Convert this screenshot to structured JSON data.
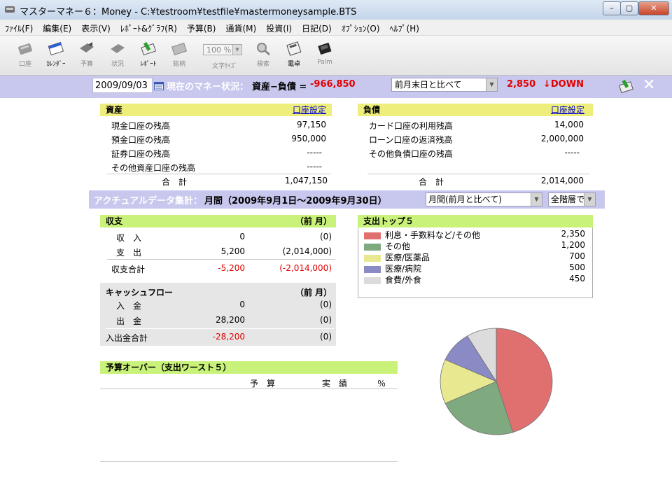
{
  "window": {
    "title": "マスターマネー６：Money - C:¥testroom¥testfile¥mastermoneysample.BTS",
    "btn_min": "–",
    "btn_max": "▢",
    "btn_close": "✕"
  },
  "menu": [
    "ﾌｧｲﾙ(F)",
    "編集(E)",
    "表示(V)",
    "ﾚﾎﾟｰﾄ&ｸﾞﾗﾌ(R)",
    "予算(B)",
    "通貨(M)",
    "投資(I)",
    "日記(D)",
    "ｵﾌﾟｼｮﾝ(O)",
    "ﾍﾙﾌﾟ(H)"
  ],
  "toolbar": {
    "items": [
      "口座",
      "ｶﾚﾝﾀﾞｰ",
      "予算",
      "状況",
      "ﾚﾎﾟｰﾄ",
      "銘柄",
      "文字ｻｲｽﾞ",
      "検索",
      "電卓",
      "Palm"
    ],
    "zoom_value": "100 ％"
  },
  "status": {
    "date": "2009/09/03",
    "money_label": "現在のマネー状況：",
    "net_label": "資産−負債 =",
    "net_value": "-966,850",
    "compare_option": "前月末日と比べて",
    "diff_value": "2,850",
    "diff_dir": "↓DOWN",
    "close": "✕"
  },
  "assets": {
    "title": "資産",
    "link": "口座設定",
    "rows": [
      {
        "label": "現金口座の残高",
        "value": "97,150"
      },
      {
        "label": "預金口座の残高",
        "value": "950,000"
      },
      {
        "label": "証券口座の残高",
        "value": "-----"
      },
      {
        "label": "その他資産口座の残高",
        "value": "-----"
      }
    ],
    "total_label": "合　計",
    "total_value": "1,047,150"
  },
  "liabilities": {
    "title": "負債",
    "link": "口座設定",
    "rows": [
      {
        "label": "カード口座の利用残高",
        "value": "14,000"
      },
      {
        "label": "ローン口座の返済残高",
        "value": "2,000,000"
      },
      {
        "label": "その他負債口座の残高",
        "value": "-----"
      }
    ],
    "total_label": "合　計",
    "total_value": "2,014,000"
  },
  "actual": {
    "label": "アクチュアルデータ集計：",
    "period": "月間（2009年9月1日〜2009年9月30日）",
    "period_select": "月間(前月と比べて)",
    "level_select": "全階層で"
  },
  "income": {
    "title": "収支",
    "prev_header": "（前 月）",
    "rows": [
      {
        "label": "収　入",
        "value": "0",
        "prev": "(0)"
      },
      {
        "label": "支　出",
        "value": "5,200",
        "prev": "(2,014,000)"
      }
    ],
    "total_label": "収支合計",
    "total_value": "-5,200",
    "total_prev": "(-2,014,000)"
  },
  "cashflow": {
    "title": "キャッシュフロー",
    "prev_header": "（前 月）",
    "rows": [
      {
        "label": "入　金",
        "value": "0",
        "prev": "(0)"
      },
      {
        "label": "出　金",
        "value": "28,200",
        "prev": "(0)"
      }
    ],
    "total_label": "入出金合計",
    "total_value": "-28,200",
    "total_prev": "(0)"
  },
  "budget": {
    "title": "予算オーバー（支出ワースト５）",
    "col_budget": "予　算",
    "col_actual": "実　績",
    "col_pct": "％"
  },
  "top5": {
    "title": "支出トップ５",
    "items": [
      {
        "label": "利息・手数料など/その他",
        "value": "2,350",
        "color": "#e07070"
      },
      {
        "label": "その他",
        "value": "1,200",
        "color": "#7faa7f"
      },
      {
        "label": "医療/医薬品",
        "value": "700",
        "color": "#e8e890"
      },
      {
        "label": "医療/病院",
        "value": "500",
        "color": "#8a8ac4"
      },
      {
        "label": "食費/外食",
        "value": "450",
        "color": "#dcdcdc"
      }
    ]
  },
  "chart_data": {
    "type": "pie",
    "categories": [
      "利息・手数料など/その他",
      "その他",
      "医療/医薬品",
      "医療/病院",
      "食費/外食"
    ],
    "values": [
      2350,
      1200,
      700,
      500,
      450
    ],
    "colors": [
      "#e07070",
      "#7faa7f",
      "#e8e890",
      "#8a8ac4",
      "#dcdcdc"
    ]
  }
}
